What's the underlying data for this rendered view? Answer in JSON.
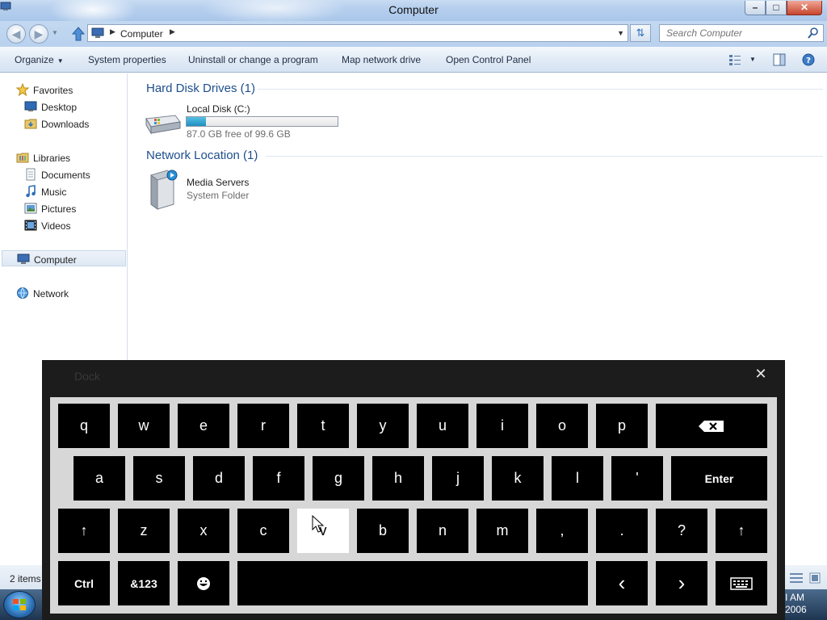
{
  "window": {
    "title": "Computer",
    "min_glyph": "–",
    "max_glyph": "□",
    "close_glyph": "✕"
  },
  "address": {
    "crumb": "Computer",
    "search_placeholder": "Search Computer"
  },
  "toolbar": {
    "organize": "Organize",
    "system_properties": "System properties",
    "uninstall": "Uninstall or change a program",
    "map_drive": "Map network drive",
    "control_panel": "Open Control Panel"
  },
  "nav": {
    "favorites": "Favorites",
    "desktop": "Desktop",
    "downloads": "Downloads",
    "libraries": "Libraries",
    "documents": "Documents",
    "music": "Music",
    "pictures": "Pictures",
    "videos": "Videos",
    "computer": "Computer",
    "network": "Network"
  },
  "content": {
    "hdd_group": "Hard Disk Drives (1)",
    "local_disk": "Local Disk (C:)",
    "local_disk_space": "87.0 GB free of 99.6 GB",
    "disk_used_fraction": 0.126,
    "net_group": "Network Location (1)",
    "media_servers": "Media Servers",
    "media_servers_type": "System Folder"
  },
  "status": {
    "items": "2 items",
    "time": "I AM",
    "date": "2006"
  },
  "keyboard": {
    "dock_label": "Dock",
    "rows": [
      [
        "q",
        "w",
        "e",
        "r",
        "t",
        "y",
        "u",
        "i",
        "o",
        "p"
      ],
      [
        "a",
        "s",
        "d",
        "f",
        "g",
        "h",
        "j",
        "k",
        "l",
        "'"
      ],
      [
        "z",
        "x",
        "c",
        "v",
        "b",
        "n",
        "m",
        ",",
        ".",
        "?"
      ]
    ],
    "enter": "Enter",
    "ctrl": "Ctrl",
    "sym": "&123",
    "left": "‹",
    "right": "›",
    "shift": "↑"
  },
  "colors": {
    "accent": "#1e4e8c",
    "progress": "#2a9fd0",
    "keyboard_bg": "#1c1c1c",
    "key": "#000000"
  }
}
